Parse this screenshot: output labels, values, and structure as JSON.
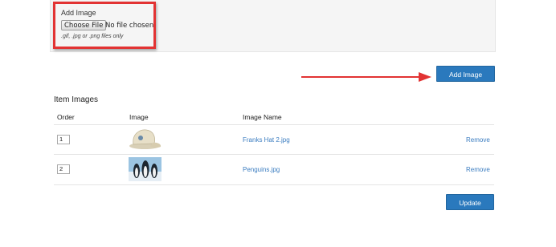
{
  "upload": {
    "label": "Add Image",
    "choose_file_button": "Choose File",
    "file_status": "No file chosen",
    "hint": ".gif, .jpg or .png files only"
  },
  "add_image_button": "Add Image",
  "item_images": {
    "title": "Item Images",
    "columns": [
      "Order",
      "Image",
      "Image Name"
    ],
    "rows": [
      {
        "order": "1",
        "image_icon": "cap-thumbnail",
        "image_name": "Franks Hat 2.jpg",
        "action": "Remove"
      },
      {
        "order": "2",
        "image_icon": "penguins-thumbnail",
        "image_name": "Penguins.jpg",
        "action": "Remove"
      }
    ]
  },
  "update_button": "Update",
  "colors": {
    "primary_button": "#2a79bd",
    "link": "#3a7cc0",
    "highlight_box": "#e23333",
    "annotation_arrow": "#e23333"
  }
}
